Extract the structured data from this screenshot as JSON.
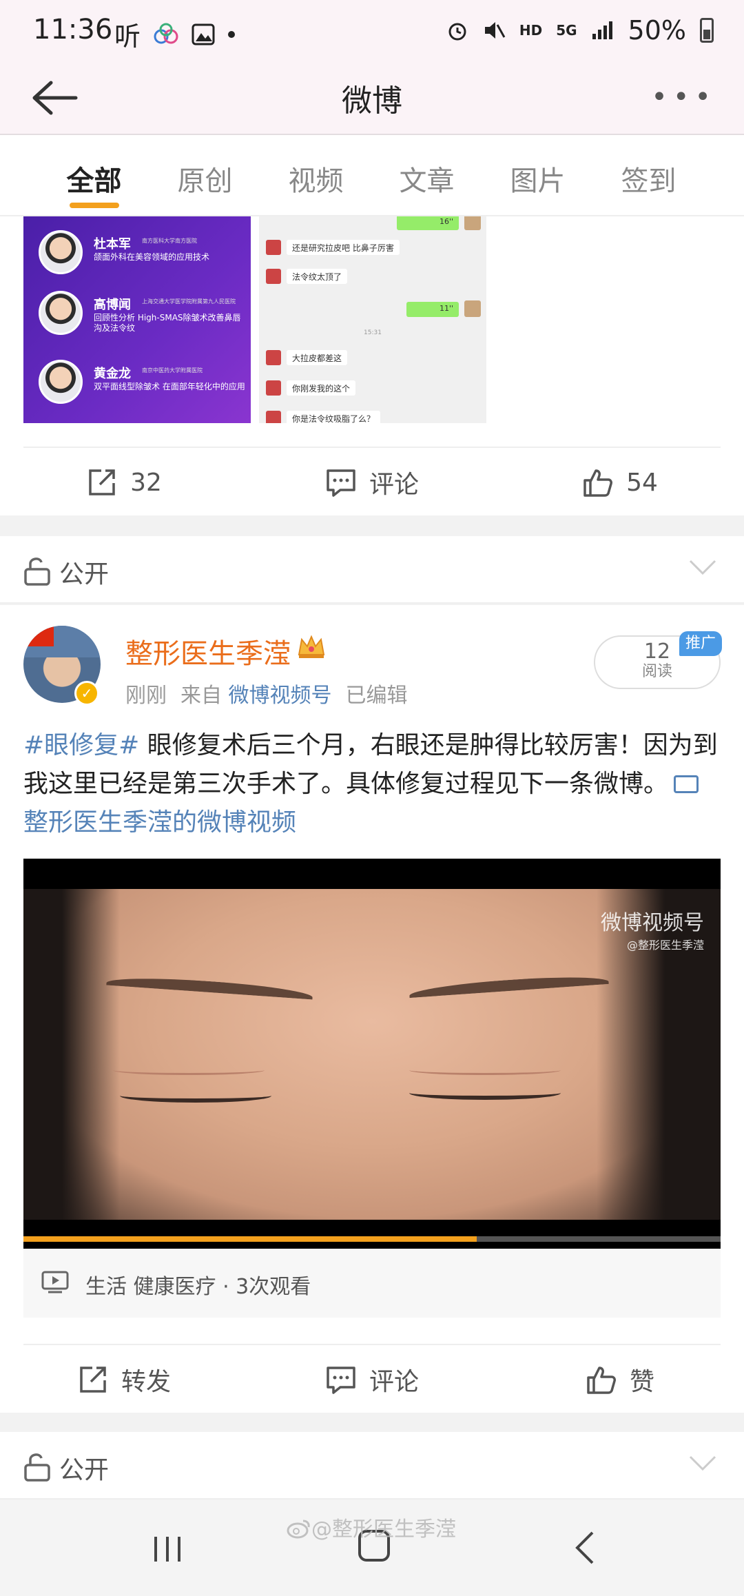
{
  "status_bar": {
    "time": "11:36",
    "ting": "听",
    "hd": "HD",
    "net": "5G",
    "battery": "50%"
  },
  "header": {
    "title": "微博",
    "more": "•••"
  },
  "tabs": [
    {
      "label": "全部",
      "active": true
    },
    {
      "label": "原创"
    },
    {
      "label": "视频"
    },
    {
      "label": "文章"
    },
    {
      "label": "图片"
    },
    {
      "label": "签到"
    }
  ],
  "prev_post": {
    "speakers": [
      {
        "name": "杜本军",
        "org": "南方医科大学南方医院",
        "desc": "颌面外科在美容领域的应用技术"
      },
      {
        "name": "高博闻",
        "org": "上海交通大学医学院附属第九人民医院",
        "desc": "回顾性分析 High-SMAS除皱术改善鼻唇沟及法令纹"
      },
      {
        "name": "黄金龙",
        "org": "南京中医药大学附属医院",
        "desc": "双平面线型除皱术 在面部年轻化中的应用"
      }
    ],
    "chat": {
      "msg1_voice": "16''",
      "msg2": "还是研究拉皮吧 比鼻子厉害",
      "msg3": "法令纹太顶了",
      "msg4_voice": "11''",
      "time": "15:31",
      "msg5": "大拉皮都差这",
      "msg6": "你刚发我的这个",
      "msg7": "你是法令纹吸脂了么？"
    },
    "actions": {
      "repost": "32",
      "comment": "评论",
      "like": "54"
    }
  },
  "public_label": "公开",
  "post": {
    "author": "整形医生季滢",
    "time": "刚刚",
    "from_label": "来自",
    "source": "微博视频号",
    "edited": "已编辑",
    "reads_count": "12",
    "reads_label": "阅读",
    "promo": "推广",
    "hashtag": "#眼修复#",
    "text": " 眼修复术后三个月，右眼还是肿得比较厉害！因为到我这里已经是第三次手术了。具体修复过程见下一条微博。",
    "video_link": "整形医生季滢的微博视频",
    "video_watermark": "微博视频号",
    "video_watermark_sub": "@整形医生季滢",
    "video_progress": 0.65,
    "video_info": "生活 健康医疗 · 3次观看",
    "actions": {
      "repost": "转发",
      "comment": "评论",
      "like": "赞"
    }
  },
  "bottom_watermark": "@整形医生季滢",
  "colors": {
    "accent": "#f3a01d",
    "author": "#ea6d1b",
    "link": "#5583b8",
    "promo": "#4b9ae5"
  }
}
